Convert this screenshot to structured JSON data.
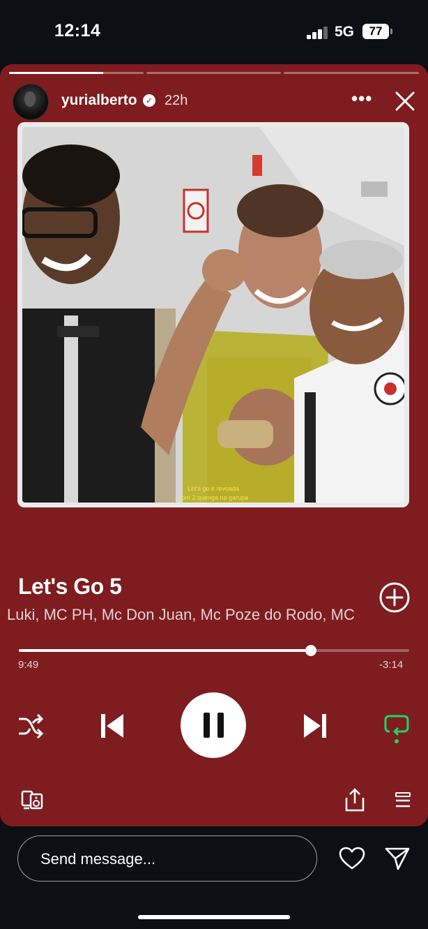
{
  "status_bar": {
    "time": "12:14",
    "network": "5G",
    "battery": "77"
  },
  "story": {
    "username": "yurialberto",
    "time_ago": "22h",
    "verified": true,
    "progress_segments": [
      0.7,
      0,
      0
    ],
    "album_art_caption_line1": "Let's go é revoada",
    "album_art_caption_line2": "com 2 quenga na garupa",
    "track": {
      "title": "Let's Go 5",
      "artists": "Luki, MC PH, Mc Don Juan, Mc Poze do Rodo, MC",
      "position": "9:49",
      "remaining": "-3:14",
      "progress_fraction": 0.748
    }
  },
  "composer": {
    "placeholder": "Send message..."
  },
  "colors": {
    "background": "#0c0f14",
    "card": "#7e1c20",
    "repeat_active": "#1ed760"
  }
}
